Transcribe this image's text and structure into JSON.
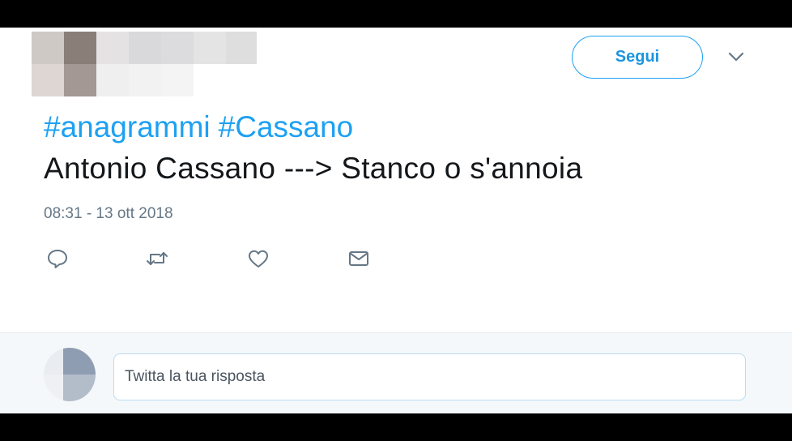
{
  "tweet": {
    "follow_label": "Segui",
    "hashtags": [
      "#anagrammi",
      "#Cassano"
    ],
    "text": "Antonio Cassano ---> Stanco o s'annoia",
    "timestamp": "08:31 - 13 ott 2018"
  },
  "reply": {
    "placeholder": "Twitta la tua risposta"
  },
  "icons": {
    "reply": "reply-icon",
    "retweet": "retweet-icon",
    "like": "heart-icon",
    "dm": "envelope-icon",
    "more": "chevron-down-icon"
  },
  "colors": {
    "accent": "#1da1f2",
    "text": "#14171a",
    "muted": "#657786",
    "reply_bg": "#f5f8fa"
  }
}
